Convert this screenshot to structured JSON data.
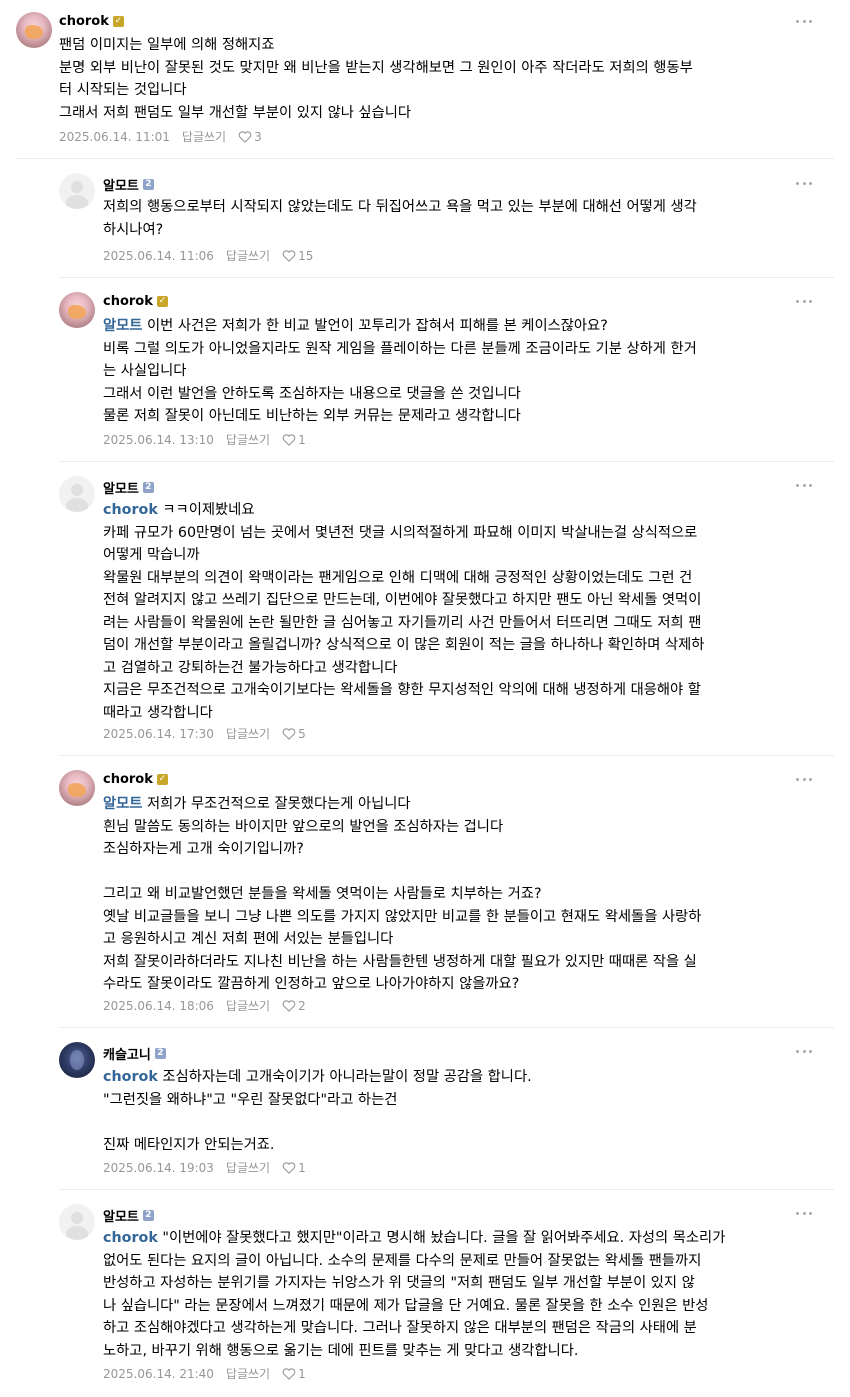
{
  "comments": [
    {
      "author": "chorok",
      "badge": "gold",
      "mention": "",
      "text": "팬덤 이미지는 일부에 의해 정해지죠\n분명 외부 비난이 잘못된 것도 맞지만 왜 비난을 받는지 생각해보면 그 원인이 아주 작더라도 저희의 행동부\n터 시작되는 것입니다\n그래서 저희 팬덤도 일부 개선할 부분이 있지 않나 싶습니다",
      "date": "2025.06.14. 11:01",
      "reply_label": "답글쓰기",
      "likes": "3"
    },
    {
      "author": "알모트",
      "badge": "blue",
      "mention": "",
      "text": "저희의 행동으로부터 시작되지 않았는데도 다 뒤집어쓰고 욕을 먹고 있는 부분에 대해선 어떻게 생각\n하시나여?",
      "date": "2025.06.14. 11:06",
      "reply_label": "답글쓰기",
      "likes": "15"
    },
    {
      "author": "chorok",
      "badge": "gold",
      "mention": "알모트",
      "text": " 이번 사건은 저희가 한 비교 발언이 꼬투리가 잡혀서 피해를 본 케이스잖아요?\n비록 그럴 의도가 아니었을지라도 원작 게임을 플레이하는 다른 분들께 조금이라도 기분 상하게 한거\n는 사실입니다\n그래서 이런 발언을 안하도록 조심하자는 내용으로 댓글을 쓴 것입니다\n물론 저희 잘못이 아닌데도 비난하는 외부 커뮤는 문제라고 생각합니다",
      "date": "2025.06.14. 13:10",
      "reply_label": "답글쓰기",
      "likes": "1"
    },
    {
      "author": "알모트",
      "badge": "blue",
      "mention": "chorok",
      "text": " ㅋㅋ이제봤네요\n카페 규모가 60만명이 넘는 곳에서 몇년전 댓글 시의적절하게 파묘해 이미지 박살내는걸 상식적으로\n어떻게 막습니까\n왁물원 대부분의 의견이 왁맥이라는 팬게임으로 인해 디맥에 대해 긍정적인 상황이었는데도 그런 건\n전혀 알려지지 않고 쓰레기 집단으로 만드는데, 이번에야 잘못했다고 하지만 팬도 아닌 왁세돌 엿먹이\n려는 사람들이 왁물원에 논란 될만한 글 심어놓고 자기들끼리 사건 만들어서 터뜨리면 그때도 저희 팬\n덤이 개선할 부분이라고 올릴겁니까? 상식적으로 이 많은 회원이 적는 글을 하나하나 확인하며 삭제하\n고 검열하고 강퇴하는건 불가능하다고 생각합니다\n지금은 무조건적으로 고개숙이기보다는 왁세돌을 향한 무지성적인 악의에 대해 냉정하게 대응해야 할\n때라고 생각합니다",
      "date": "2025.06.14. 17:30",
      "reply_label": "답글쓰기",
      "likes": "5"
    },
    {
      "author": "chorok",
      "badge": "gold",
      "mention": "알모트",
      "text": " 저희가 무조건적으로 잘못했다는게 아닙니다\n흰님 말씀도 동의하는 바이지만 앞으로의 발언을 조심하자는 겁니다\n조심하자는게 고개 숙이기입니까?\n\n그리고 왜 비교발언했던 분들을 왁세돌 엿먹이는 사람들로 치부하는 거죠?\n옛날 비교글들을 보니 그냥 나쁜 의도를 가지지 않았지만 비교를 한 분들이고 현재도 왁세돌을 사랑하\n고 응원하시고 계신 저희 편에 서있는 분들입니다\n저희 잘못이라하더라도 지나친 비난을 하는 사람들한텐 냉정하게 대할 필요가 있지만 때때론 작을 실\n수라도 잘못이라도 깔끔하게 인정하고 앞으로 나아가야하지 않을까요?",
      "date": "2025.06.14. 18:06",
      "reply_label": "답글쓰기",
      "likes": "2"
    },
    {
      "author": "캐슬고니",
      "badge": "blue",
      "mention": "chorok",
      "text": " 조심하자는데 고개숙이기가 아니라는말이 정말 공감을 합니다.\n\"그런짓을 왜하냐\"고 \"우린 잘못없다\"라고 하는건\n\n진짜 메타인지가 안되는거죠.",
      "date": "2025.06.14. 19:03",
      "reply_label": "답글쓰기",
      "likes": "1"
    },
    {
      "author": "알모트",
      "badge": "blue",
      "mention": "chorok",
      "text": " \"이번에야 잘못했다고 했지만\"이라고 명시해 놨습니다. 글을 잘 읽어봐주세요. 자성의 목소리가\n없어도 된다는 요지의 글이 아닙니다. 소수의 문제를 다수의 문제로 만들어 잘못없는 왁세돌 팬들까지\n반성하고 자성하는 분위기를 가지자는 뉘앙스가 위 댓글의 \"저희 팬덤도 일부 개선할 부분이 있지 않\n나 싶습니다\" 라는 문장에서 느껴졌기 때문에 제가 답글을 단 거예요. 물론 잘못을 한 소수 인원은 반성\n하고 조심해야겠다고 생각하는게 맞습니다. 그러나 잘못하지 않은 대부분의 팬덤은 작금의 사태에 분\n노하고, 바꾸기 위해 행동으로 옮기는 데에 핀트를 맞추는 게 맞다고 생각합니다.",
      "date": "2025.06.14. 21:40",
      "reply_label": "답글쓰기",
      "likes": "1"
    }
  ],
  "icons": {
    "more": "more-dots-icon",
    "like": "heart-icon",
    "badge": "level-badge-icon"
  },
  "colors": {
    "mention": "#336699",
    "meta": "#979797",
    "divider": "#ebebeb",
    "badge_gold": "#c8a62a",
    "badge_blue": "#8ea3c9"
  }
}
